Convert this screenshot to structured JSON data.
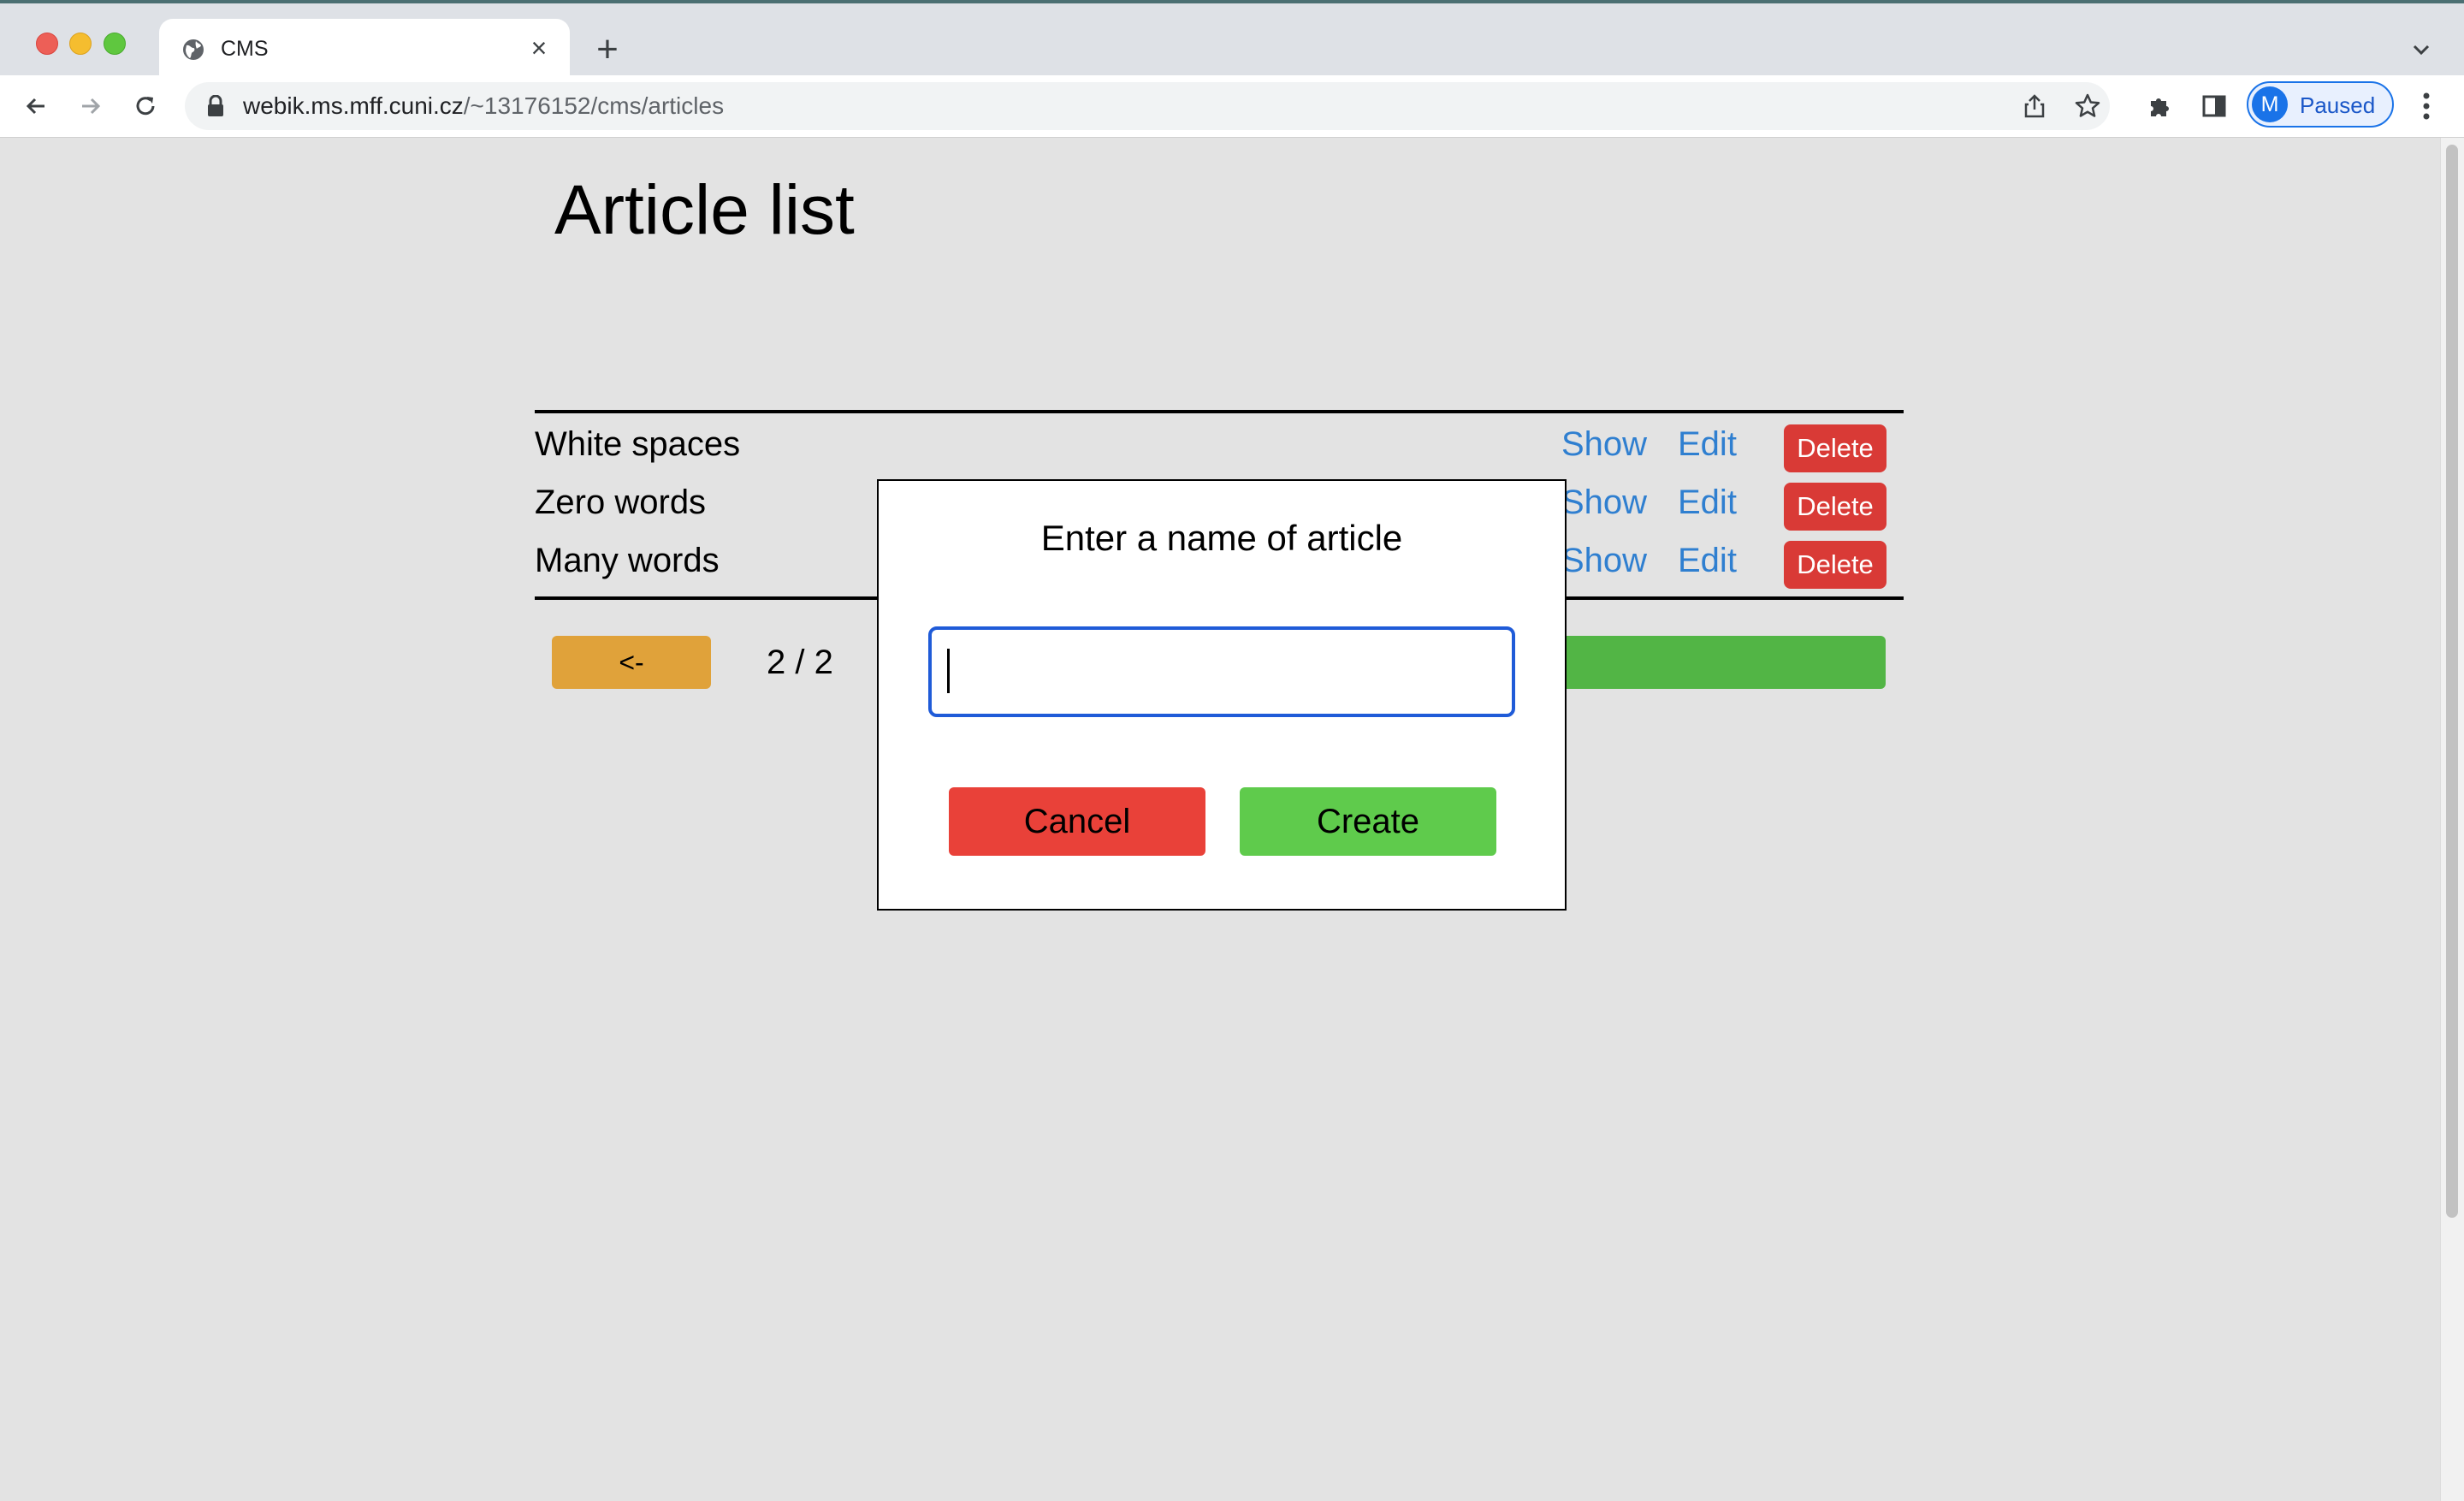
{
  "browser": {
    "tab_title": "CMS",
    "url_host": "webik.ms.mff.cuni.cz",
    "url_path": "/~13176152/cms/articles",
    "profile_initial": "M",
    "profile_status": "Paused"
  },
  "page": {
    "title": "Article list",
    "articles": [
      {
        "name": "White spaces",
        "show": "Show",
        "edit": "Edit",
        "delete": "Delete"
      },
      {
        "name": "Zero words",
        "show": "Show",
        "edit": "Edit",
        "delete": "Delete"
      },
      {
        "name": "Many words",
        "show": "Show",
        "edit": "Edit",
        "delete": "Delete"
      }
    ],
    "prev_label": "<-",
    "pager": "2 / 2"
  },
  "modal": {
    "title": "Enter a name of article",
    "input_value": "",
    "cancel_label": "Cancel",
    "create_label": "Create"
  },
  "colors": {
    "delete": "#d93a36",
    "link": "#2f7fd0",
    "prev": "#e0a23a",
    "create": "#5fcb4c",
    "cancel": "#e94139",
    "focus": "#1f5bd8"
  }
}
